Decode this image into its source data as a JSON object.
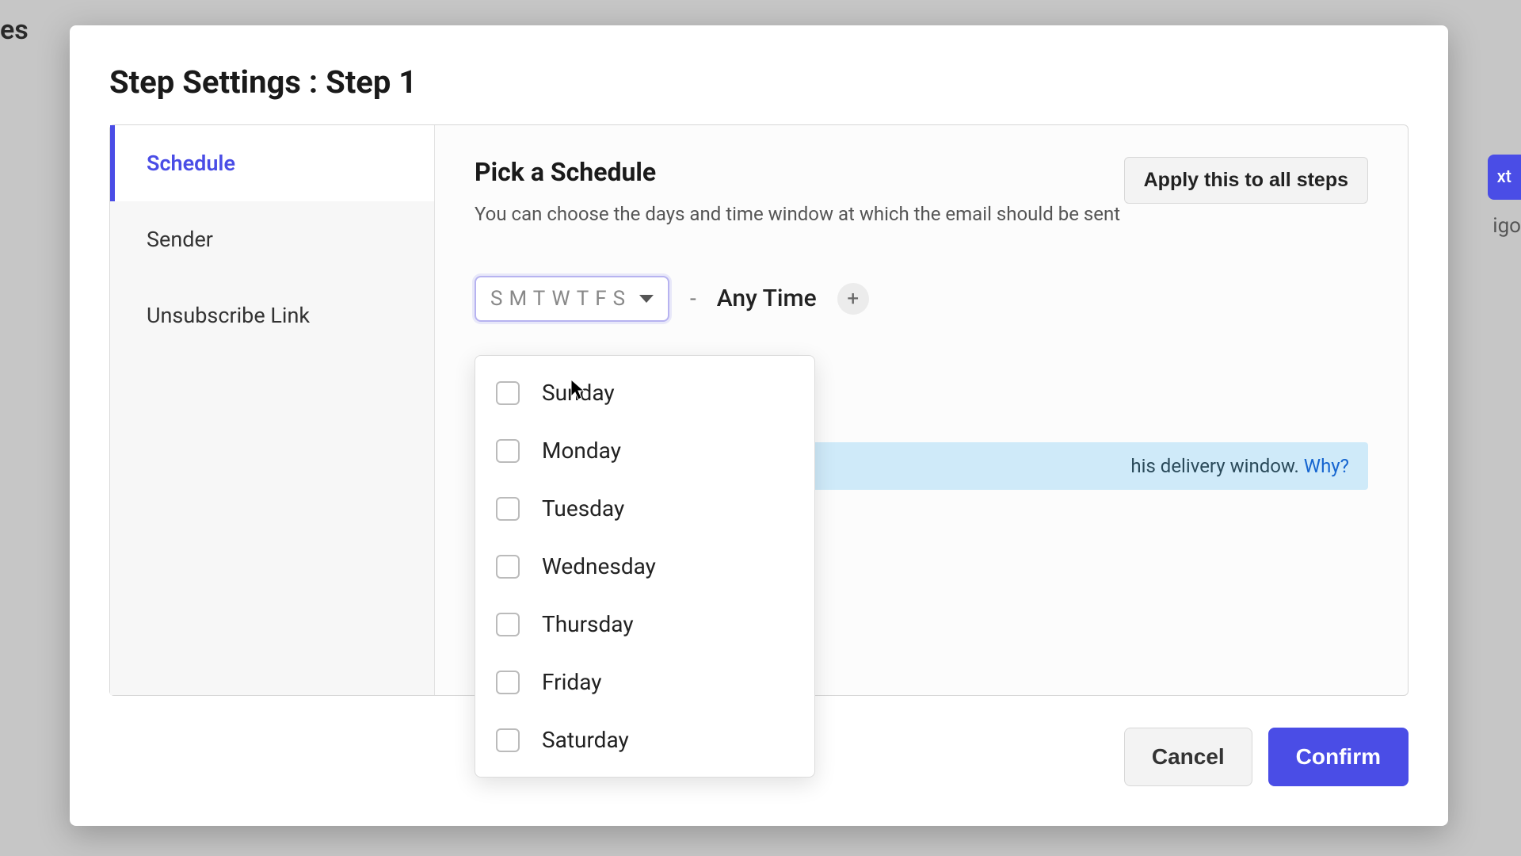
{
  "background": {
    "text_left": "es",
    "button_right": "xt",
    "text_ago": "igo"
  },
  "modal": {
    "title": "Step Settings : Step 1",
    "tabs": [
      {
        "label": "Schedule",
        "active": true
      },
      {
        "label": "Sender",
        "active": false
      },
      {
        "label": "Unsubscribe Link",
        "active": false
      }
    ],
    "content": {
      "heading": "Pick a Schedule",
      "description": "You can choose the days and time window at which the email should be sent",
      "apply_button": "Apply this to all steps",
      "days_abbrev": "SMTWTFS",
      "dash": "-",
      "time_label": "Any Time",
      "banner_text": "his delivery window. ",
      "banner_link": "Why?"
    },
    "dropdown": {
      "options": [
        {
          "label": "Sunday",
          "checked": false
        },
        {
          "label": "Monday",
          "checked": false
        },
        {
          "label": "Tuesday",
          "checked": false
        },
        {
          "label": "Wednesday",
          "checked": false
        },
        {
          "label": "Thursday",
          "checked": false
        },
        {
          "label": "Friday",
          "checked": false
        },
        {
          "label": "Saturday",
          "checked": false
        }
      ]
    },
    "footer": {
      "cancel": "Cancel",
      "confirm": "Confirm"
    }
  }
}
